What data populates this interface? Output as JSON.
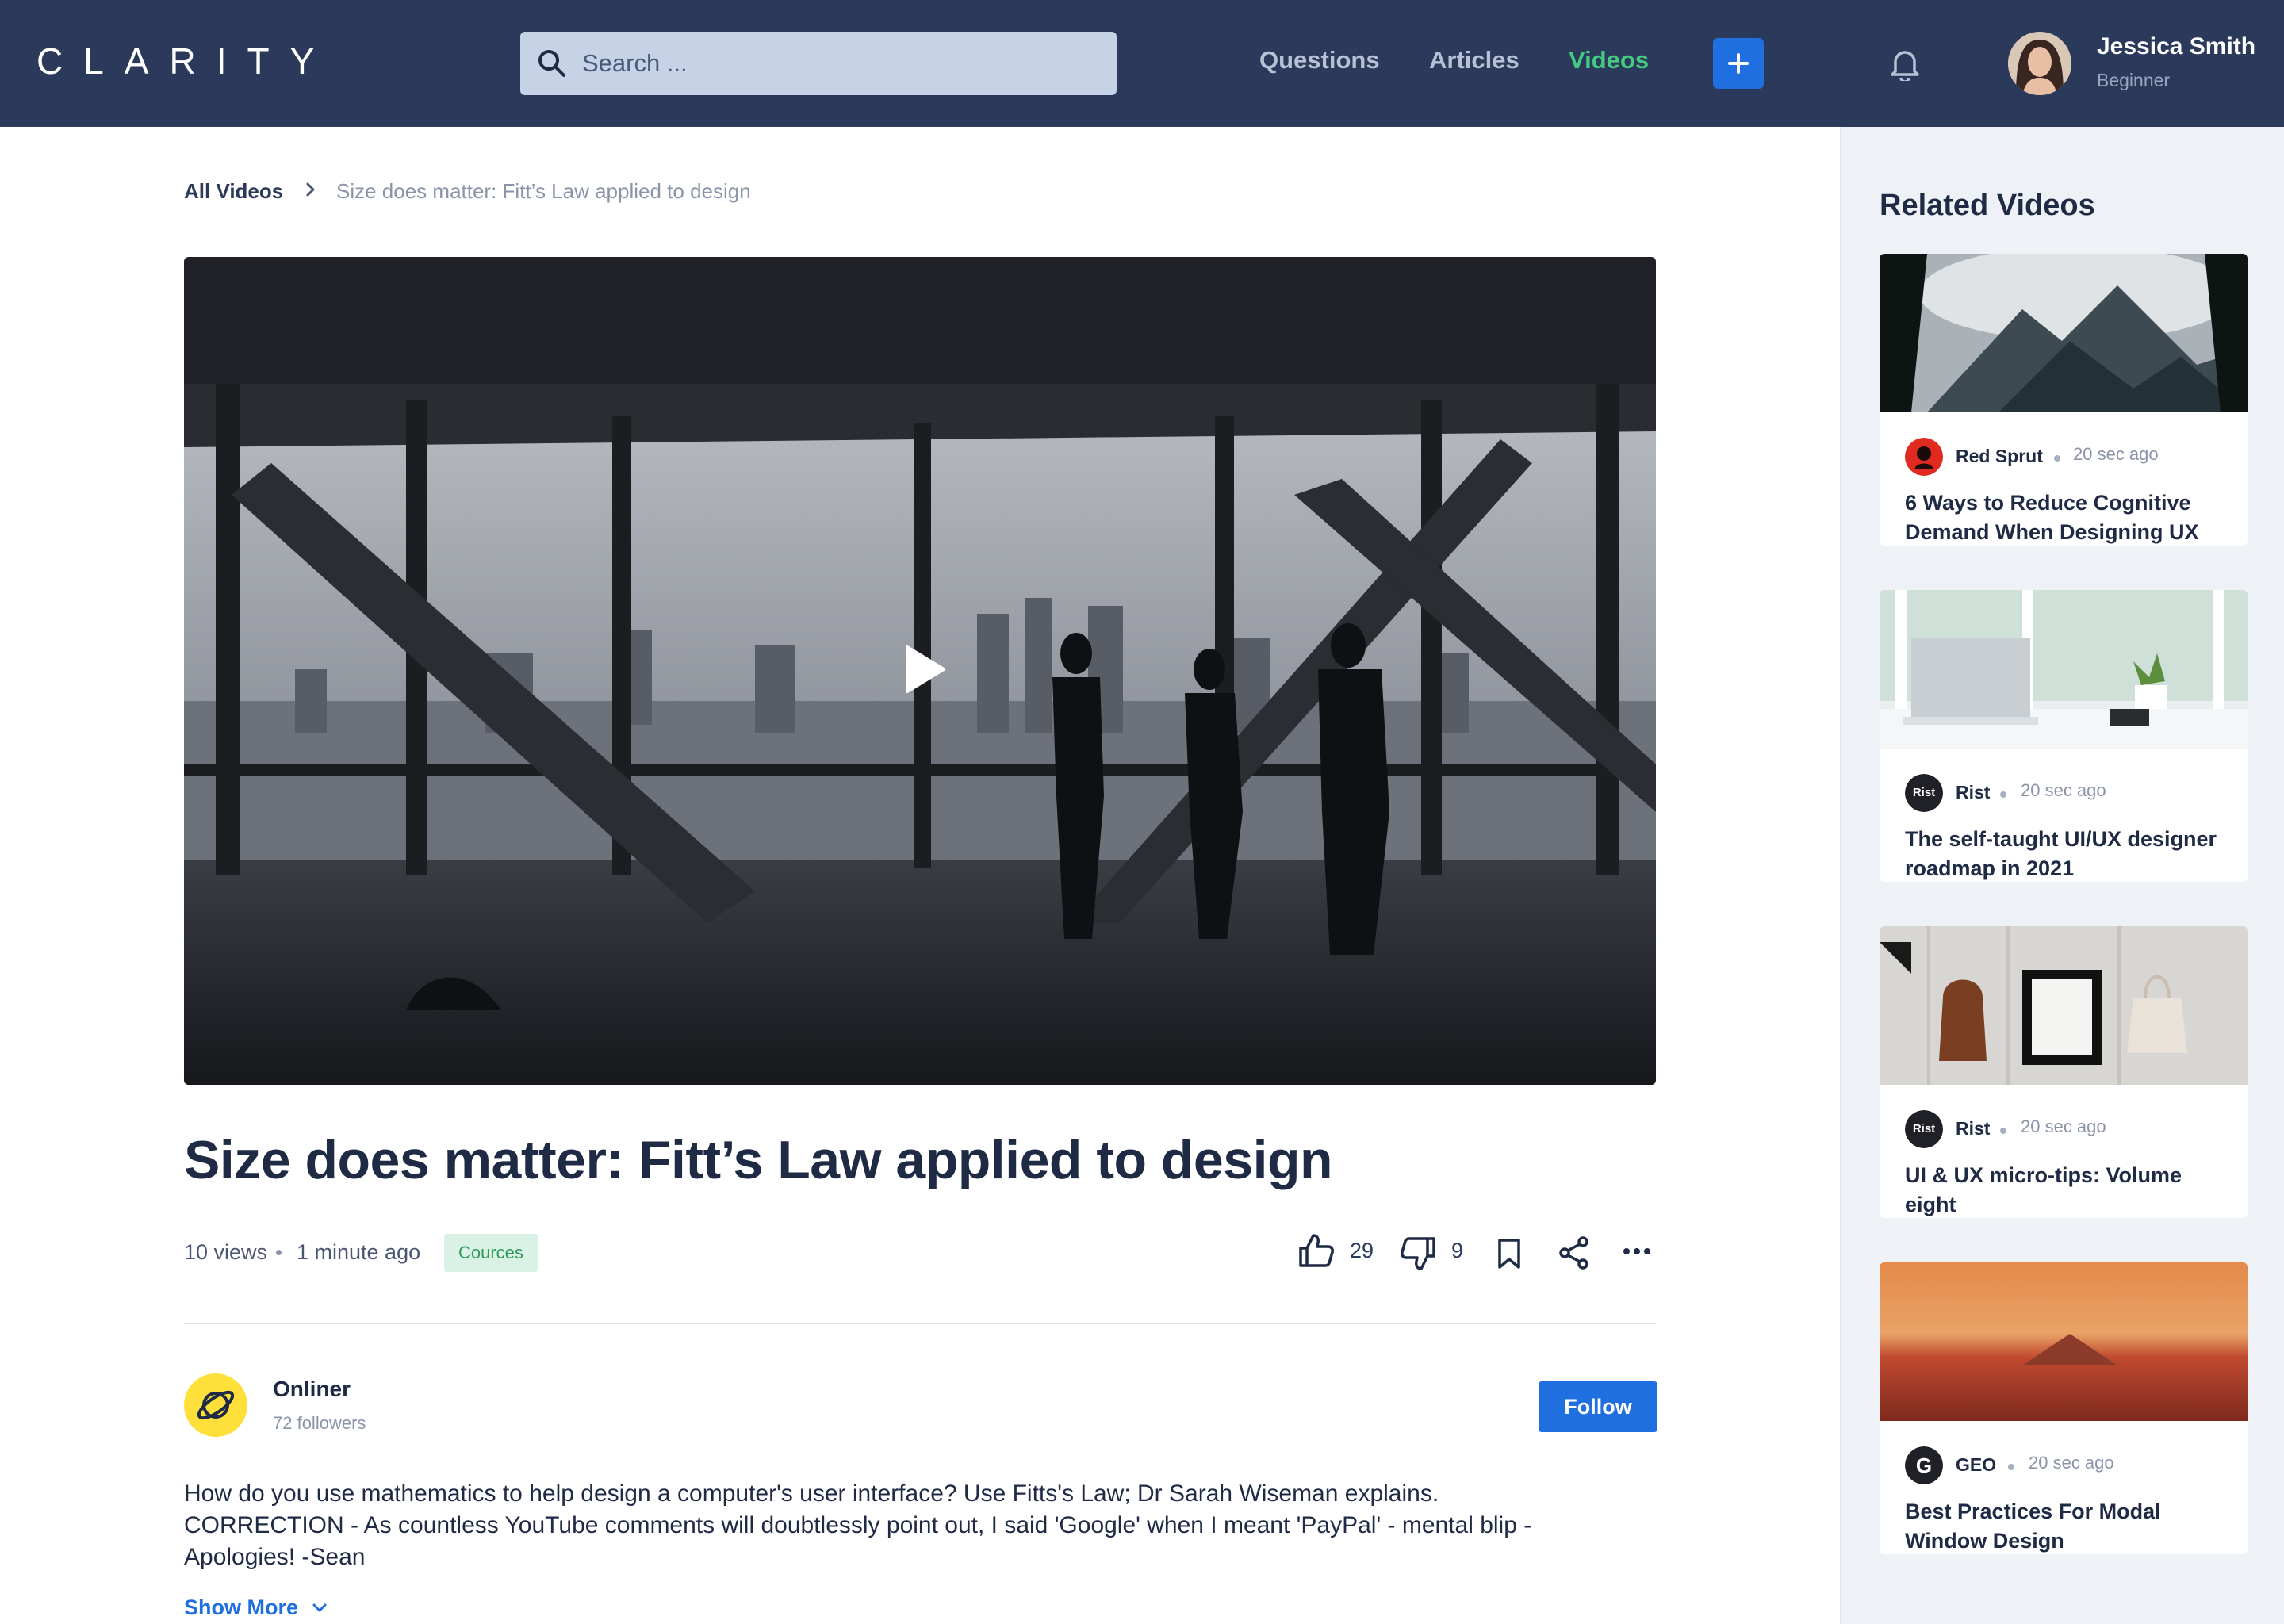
{
  "brand": {
    "logo": "CLARITY"
  },
  "search": {
    "placeholder": "Search ..."
  },
  "nav": {
    "questions": "Questions",
    "articles": "Articles",
    "videos": "Videos",
    "active": "videos"
  },
  "user": {
    "name": "Jessica Smith",
    "level": "Beginner"
  },
  "colors": {
    "topbar": "#2b3a5a",
    "accent": "#1f6fe0",
    "active_nav": "#44c980",
    "tag_bg": "#daf2e5",
    "tag_text": "#2e9a5c",
    "sidebar_bg": "#eef1f6"
  },
  "breadcrumb": {
    "root": "All Videos",
    "current": "Size does matter: Fitt’s Law applied to design"
  },
  "video": {
    "title": "Size does matter: Fitt’s Law applied to design",
    "views": "10 views",
    "posted": "1 minute ago",
    "tag": "Cources",
    "likes": "29",
    "dislikes": "9",
    "icons": [
      "play-icon",
      "thumbs-up-icon",
      "thumbs-down-icon",
      "bookmark-icon",
      "share-icon",
      "more-icon"
    ]
  },
  "channel": {
    "name": "Onliner",
    "followers": "72 followers",
    "follow_label": "Follow"
  },
  "description": {
    "line1": "How do you use mathematics to help design a computer's user interface? Use Fitts's Law; Dr Sarah Wiseman explains.",
    "line2": "CORRECTION - As countless YouTube comments will doubtlessly point out, I said 'Google' when I meant 'PayPal' - mental blip -",
    "line3": "Apologies! -Sean",
    "show_more": "Show More"
  },
  "related": {
    "heading": "Related Videos",
    "items": [
      {
        "channel": "Red Sprut",
        "time": "20 sec ago",
        "title": "6 Ways to Reduce Cognitive Demand When Designing UX",
        "logo_text": ""
      },
      {
        "channel": "Rist",
        "time": "20 sec ago",
        "title": "The self-taught UI/UX designer roadmap in 2021",
        "logo_text": "Rist"
      },
      {
        "channel": "Rist",
        "time": "20 sec ago",
        "title": "UI & UX micro-tips: Volume eight",
        "logo_text": "Rist"
      },
      {
        "channel": "GEO",
        "time": "20 sec ago",
        "title": "Best Practices For Modal Window Design",
        "logo_text": "G"
      }
    ]
  }
}
